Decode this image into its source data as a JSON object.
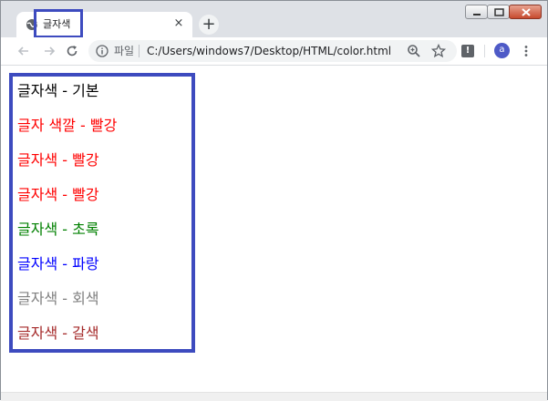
{
  "browser": {
    "tab": {
      "title": "글자색",
      "favicon": "globe-icon",
      "close_glyph": "×"
    },
    "new_tab_glyph": "+",
    "address_bar": {
      "scheme_label": "파일",
      "url": "C:/Users/windows7/Desktop/HTML/color.html"
    },
    "profile_initial": "a",
    "extension_label": "!"
  },
  "page": {
    "lines": [
      {
        "text": "글자색 - 기본",
        "color": "#000000"
      },
      {
        "text": "글자 색깔 - 빨강",
        "color": "#ff0000"
      },
      {
        "text": "글자색 - 빨강",
        "color": "#ff0000"
      },
      {
        "text": "글자색 - 빨강",
        "color": "#ff0000"
      },
      {
        "text": "글자색 - 초록",
        "color": "#008000"
      },
      {
        "text": "글자색 - 파랑",
        "color": "#0000ff"
      },
      {
        "text": "글자색 - 회색",
        "color": "#808080"
      },
      {
        "text": "글자색 - 갈색",
        "color": "#a52a2a"
      }
    ]
  },
  "annotation_color": "#3d4bbf"
}
